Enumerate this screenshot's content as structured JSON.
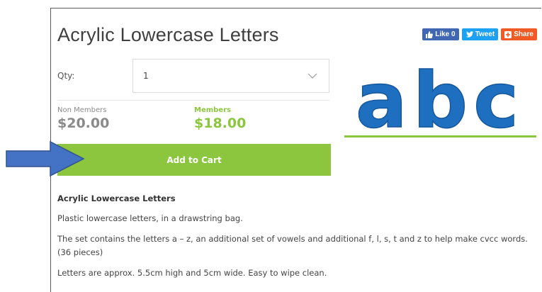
{
  "product": {
    "title": "Acrylic Lowercase Letters",
    "image_text": "abc"
  },
  "social": {
    "like_label": "Like 0",
    "tweet_label": "Tweet",
    "share_label": "Share"
  },
  "quantity": {
    "label": "Qty:",
    "value": "1"
  },
  "pricing": {
    "non_members_label": "Non Members",
    "non_members_price": "$20.00",
    "members_label": "Members",
    "members_price": "$18.00"
  },
  "cart": {
    "button_label": "Add to Cart"
  },
  "description": {
    "heading": "Acrylic Lowercase Letters",
    "paragraphs": [
      "Plastic lowercase letters, in a drawstring bag.",
      "The set contains the letters a – z, an additional set of vowels and additional f, l, s, t and z to help make cvcc words. (36 pieces)",
      "Letters are approx. 5.5cm high and 5cm wide. Easy to wipe clean."
    ]
  },
  "colors": {
    "accent_green": "#8cc63f",
    "letters_blue": "#1f6fc0",
    "arrow_blue": "#4472c4",
    "facebook": "#4267b2",
    "twitter": "#1da1f2",
    "share": "#f05a24"
  },
  "icons": {
    "like": "thumbs-up-icon",
    "tweet": "twitter-bird-icon",
    "share": "plus-icon",
    "select": "chevron-down-icon",
    "annotation": "right-arrow-icon"
  }
}
